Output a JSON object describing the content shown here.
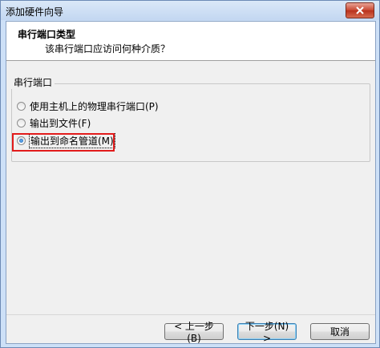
{
  "window": {
    "title": "添加硬件向导"
  },
  "header": {
    "title": "串行端口类型",
    "subtitle": "该串行端口应访问何种介质？"
  },
  "group": {
    "legend": "串行端口",
    "options": [
      {
        "label": "使用主机上的物理串行端口(P)",
        "checked": false
      },
      {
        "label": "输出到文件(F)",
        "checked": false
      },
      {
        "label": "输出到命名管道(M)",
        "checked": true
      }
    ]
  },
  "buttons": {
    "back": "< 上一步(B)",
    "next": "下一步(N) >",
    "cancel": "取消"
  },
  "colors": {
    "highlight": "#e21b1b",
    "accent": "#3c7fb1"
  }
}
